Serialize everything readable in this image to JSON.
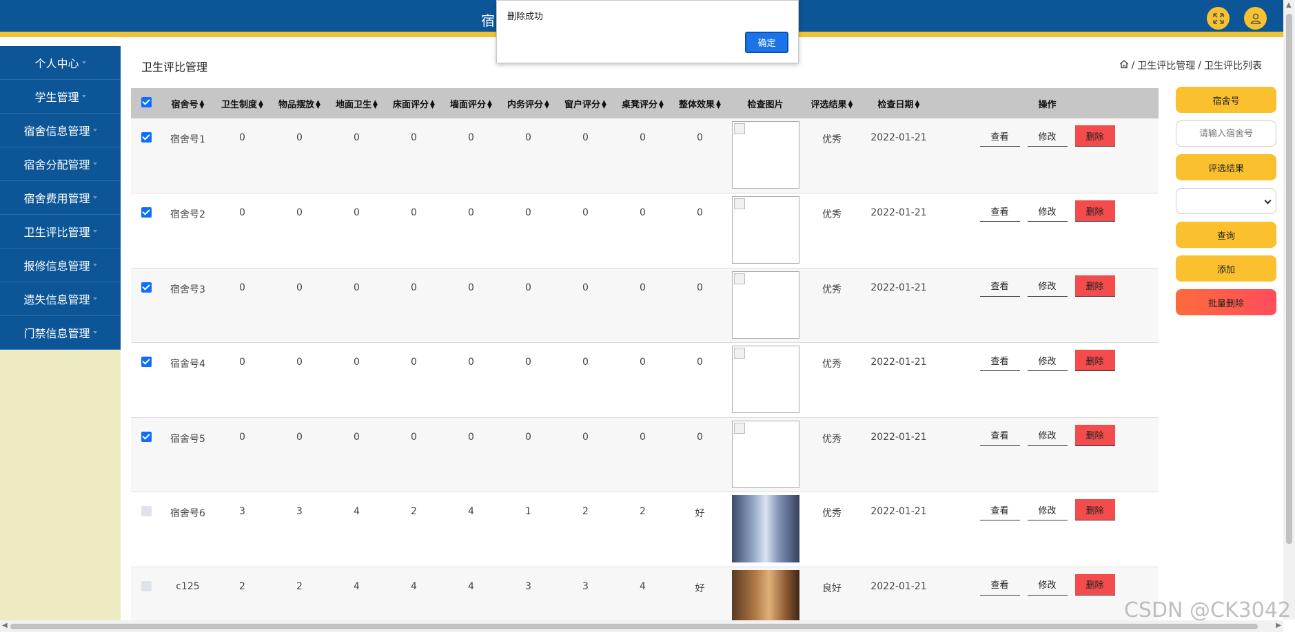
{
  "header": {
    "title": "宿",
    "fullscreen_icon": "fullscreen-icon",
    "user_icon": "user-icon",
    "colors": {
      "bar": "#0c5597",
      "stripe": "#f2c232",
      "icon_bg": "#f7c22e"
    }
  },
  "sidebar": {
    "items": [
      {
        "label": "个人中心"
      },
      {
        "label": "学生管理"
      },
      {
        "label": "宿舍信息管理"
      },
      {
        "label": "宿舍分配管理"
      },
      {
        "label": "宿舍费用管理"
      },
      {
        "label": "卫生评比管理"
      },
      {
        "label": "报修信息管理"
      },
      {
        "label": "遗失信息管理"
      },
      {
        "label": "门禁信息管理"
      }
    ]
  },
  "page": {
    "title": "卫生评比管理",
    "breadcrumb": {
      "home_icon": "home-icon",
      "level1": "卫生评比管理",
      "level2": "卫生评比列表",
      "sep": "/"
    }
  },
  "table": {
    "columns": [
      "宿舍号",
      "卫生制度",
      "物品摆放",
      "地面卫生",
      "床面评分",
      "墙面评分",
      "内务评分",
      "窗户评分",
      "桌凳评分",
      "整体效果",
      "检查图片",
      "评选结果",
      "检查日期",
      "操作"
    ],
    "sortable": [
      true,
      true,
      true,
      true,
      true,
      true,
      true,
      true,
      true,
      true,
      false,
      true,
      true,
      false
    ],
    "header_checked": true,
    "actions": {
      "view": "查看",
      "edit": "修改",
      "delete": "删除"
    },
    "rows": [
      {
        "checked": true,
        "dorm": "宿舍号1",
        "s1": "0",
        "s2": "0",
        "s3": "0",
        "s4": "0",
        "s5": "0",
        "s6": "0",
        "s7": "0",
        "s8": "0",
        "overall": "0",
        "image": "broken",
        "result": "优秀",
        "date": "2022-01-21"
      },
      {
        "checked": true,
        "dorm": "宿舍号2",
        "s1": "0",
        "s2": "0",
        "s3": "0",
        "s4": "0",
        "s5": "0",
        "s6": "0",
        "s7": "0",
        "s8": "0",
        "overall": "0",
        "image": "broken",
        "result": "优秀",
        "date": "2022-01-21"
      },
      {
        "checked": true,
        "dorm": "宿舍号3",
        "s1": "0",
        "s2": "0",
        "s3": "0",
        "s4": "0",
        "s5": "0",
        "s6": "0",
        "s7": "0",
        "s8": "0",
        "overall": "0",
        "image": "broken",
        "result": "优秀",
        "date": "2022-01-21"
      },
      {
        "checked": true,
        "dorm": "宿舍号4",
        "s1": "0",
        "s2": "0",
        "s3": "0",
        "s4": "0",
        "s5": "0",
        "s6": "0",
        "s7": "0",
        "s8": "0",
        "overall": "0",
        "image": "broken",
        "result": "优秀",
        "date": "2022-01-21"
      },
      {
        "checked": true,
        "dorm": "宿舍号5",
        "s1": "0",
        "s2": "0",
        "s3": "0",
        "s4": "0",
        "s5": "0",
        "s6": "0",
        "s7": "0",
        "s8": "0",
        "overall": "0",
        "image": "broken",
        "result": "优秀",
        "date": "2022-01-21"
      },
      {
        "checked": false,
        "dorm": "宿舍号6",
        "s1": "3",
        "s2": "3",
        "s3": "4",
        "s4": "2",
        "s5": "4",
        "s6": "1",
        "s7": "2",
        "s8": "2",
        "overall": "好",
        "image": "photo1",
        "result": "优秀",
        "date": "2022-01-21"
      },
      {
        "checked": false,
        "dorm": "c125",
        "s1": "2",
        "s2": "2",
        "s3": "4",
        "s4": "4",
        "s5": "4",
        "s6": "3",
        "s7": "3",
        "s8": "4",
        "overall": "好",
        "image": "photo2",
        "result": "良好",
        "date": "2022-01-21"
      }
    ]
  },
  "search_panel": {
    "dorm_label": "宿舍号",
    "dorm_placeholder": "请输入宿舍号",
    "result_label": "评选结果",
    "result_value": "",
    "query": "查询",
    "add": "添加",
    "batch_delete": "批量删除"
  },
  "dialog": {
    "message": "删除成功",
    "ok": "确定"
  },
  "watermark": "CSDN @CK3042"
}
